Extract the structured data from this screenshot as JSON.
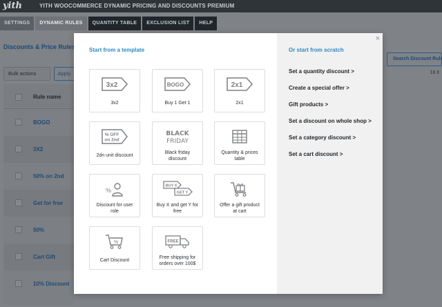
{
  "app": {
    "logo": "yith",
    "plugin_title": "YITH WOOCOMMERCE DYNAMIC PRICING AND DISCOUNTS PREMIUM"
  },
  "tabs": [
    {
      "label": "SETTINGS"
    },
    {
      "label": "DYNAMIC RULES"
    },
    {
      "label": "QUANTITY TABLE"
    },
    {
      "label": "EXCLUSION LIST"
    },
    {
      "label": "HELP"
    }
  ],
  "page": {
    "heading": "Discounts & Price Rules",
    "bulk_actions": "Bulk actions",
    "apply": "Apply",
    "search_button": "Search Discount Rule",
    "items_count": "16 it",
    "column_header": "Rule name",
    "rows": [
      {
        "label": "BOGO"
      },
      {
        "label": "3X2"
      },
      {
        "label": "50% on 2nd"
      },
      {
        "label": "Get for free"
      },
      {
        "label": "50%"
      },
      {
        "label": "Cart Gift"
      },
      {
        "label": "10% Discount"
      }
    ]
  },
  "modal": {
    "close": "×",
    "left_title": "Start from a template",
    "right_title": "Or start from scratch",
    "templates": [
      {
        "label": "3x2",
        "icon": "3x2-tag-icon",
        "icon_text": "3x2"
      },
      {
        "label": "Buy 1 Get 1",
        "icon": "bogo-tag-icon",
        "icon_text": "BOGO"
      },
      {
        "label": "2x1",
        "icon": "2x1-tag-icon",
        "icon_text": "2x1"
      },
      {
        "label": "2dn unit discount",
        "icon": "percent-off-tag-icon",
        "icon_text_1": "% OFF",
        "icon_text_2": "on 2nd"
      },
      {
        "label": "Black friday discount",
        "icon": "black-friday-icon",
        "icon_text_1": "BLACK",
        "icon_text_2": "FRIDAY"
      },
      {
        "label": "Quantity & prices table",
        "icon": "table-icon"
      },
      {
        "label": "Discount for user role",
        "icon": "user-role-icon"
      },
      {
        "label": "Buy X and get Y for free",
        "icon": "buy-x-get-y-icon",
        "icon_text_1": "BUY X",
        "icon_text_2": "GET Y"
      },
      {
        "label": "Offer a gift product at cart",
        "icon": "gift-cart-icon"
      },
      {
        "label": "Cart Discount",
        "icon": "cart-discount-icon"
      },
      {
        "label": "Free shipping for orders over 100$",
        "icon": "free-shipping-truck-icon",
        "icon_text": "FREE"
      }
    ],
    "scratch_options": [
      {
        "label": "Set a quantity discount >"
      },
      {
        "label": "Create a special offer >"
      },
      {
        "label": "Gift products >"
      },
      {
        "label": "Set a discount on whole shop >"
      },
      {
        "label": "Set a category discount >"
      },
      {
        "label": "Set a cart discount >"
      }
    ]
  },
  "colors": {
    "accent": "#2e8ac3",
    "overlay_bg": "#7f8287",
    "icon_gray": "#7d7f83"
  }
}
